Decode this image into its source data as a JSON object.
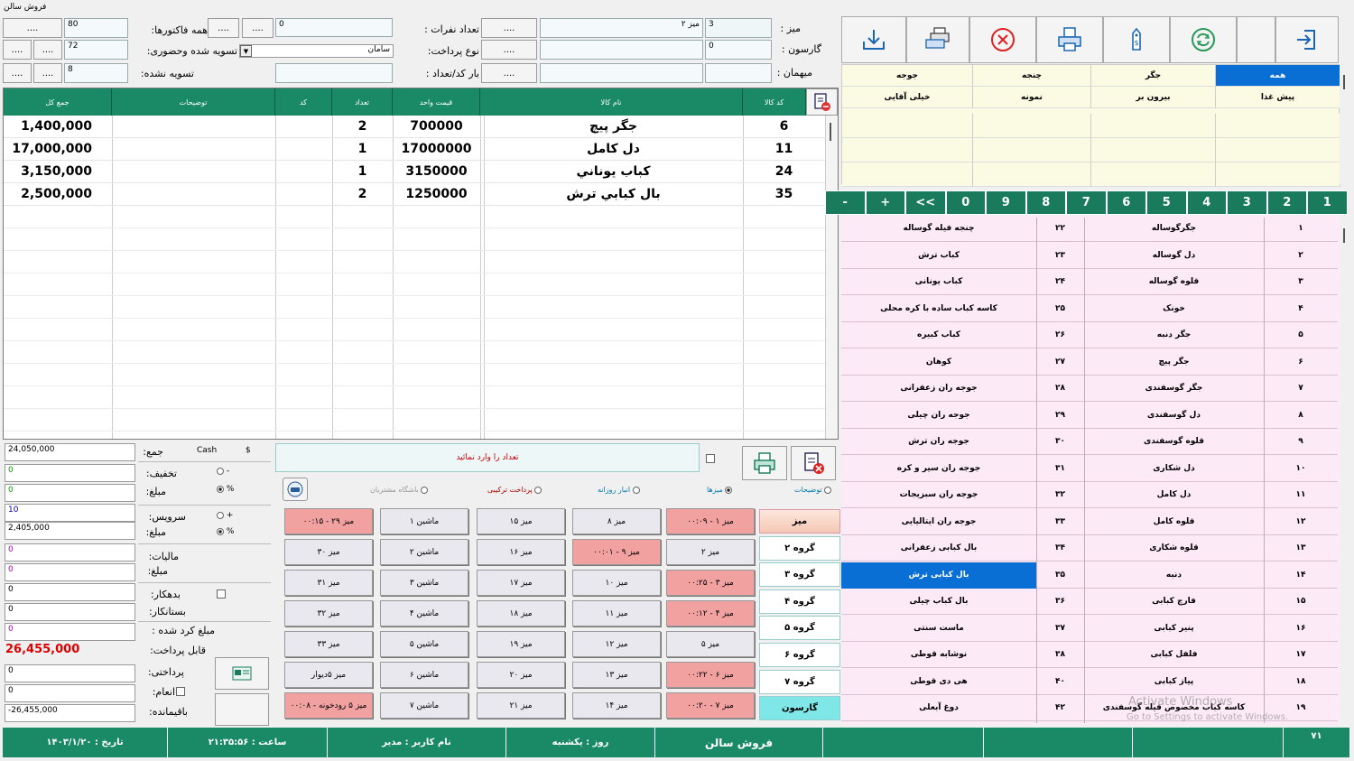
{
  "window": {
    "title": "فروش سالن"
  },
  "header": {
    "table_label": "میز :",
    "table_value": "3",
    "table_name": "میز ۲",
    "waiter_label": "گارسون :",
    "waiter_value": "0",
    "guest_label": "میهمان :",
    "people_label": "تعداد نفرات :",
    "people_value": "0",
    "paytype_label": "نوع پرداخت:",
    "paytype_value": "سامان",
    "barcode_label": "بار کد/تعداد :",
    "all_invoices_label": "همه فاکتورها:",
    "all_invoices_value": "80",
    "settled_label": "تسویه شده وحضوری:",
    "settled_value": "72",
    "unsettled_label": "تسویه نشده:",
    "unsettled_value": "8",
    "ellipsis": "...."
  },
  "grid": {
    "headers": {
      "code": "کد کالا",
      "name": "نام کالا",
      "price": "قیمت واحد",
      "qty": "تعداد",
      "kod": "کد",
      "desc": "توضیحات",
      "total": "جمع کل"
    },
    "rows": [
      {
        "code": "6",
        "name": "جگر پیچ",
        "price": "700000",
        "qty": "2",
        "total": "1,400,000"
      },
      {
        "code": "11",
        "name": "دل کامل",
        "price": "17000000",
        "qty": "1",
        "total": "17,000,000"
      },
      {
        "code": "24",
        "name": "كباب يوناني",
        "price": "3150000",
        "qty": "1",
        "total": "3,150,000"
      },
      {
        "code": "35",
        "name": "بال كبابي ترش",
        "price": "1250000",
        "qty": "2",
        "total": "2,500,000"
      }
    ]
  },
  "summary": {
    "sum_label": "جمع:",
    "sum_value": "24,050,000",
    "cash": "Cash",
    "dollar": "$",
    "discount_label": "تخفیف:",
    "discount_pct": "0",
    "amount_label": "مبلغ:",
    "discount_amount": "0",
    "minus": "-",
    "percent": "%",
    "plus": "+",
    "service_label": "سرویس:",
    "service_pct": "10",
    "service_amount": "2,405,000",
    "tax_label": "مالیات:",
    "tax_amount_label": "مبلغ:",
    "tax_pct": "0",
    "tax_amount": "0",
    "debtor_label": "بدهکار:",
    "debtor_value": "0",
    "creditor_label": "بستانکار:",
    "creditor_value": "0",
    "credited_label": "مبلغ کرد شده :",
    "credited_value": "0",
    "payable_label": "قابل پرداخت:",
    "payable_value": "26,455,000",
    "paid_label": "پرداختی:",
    "paid_value": "0",
    "tip_label": "انعام:",
    "tip_value": "0",
    "remain_label": "باقیمانده:",
    "remain_value": "-26,455,000"
  },
  "messages": {
    "enter_qty": "تعداد را وارد نمائید"
  },
  "options": {
    "desc": "توضیحات",
    "tables": "میزها",
    "daily": "انبار روزانه",
    "combined": "پرداخت ترکیبی",
    "club": "باشگاه مشتریان"
  },
  "tables": [
    [
      "میز ۱ - ۰۰:۰۹",
      "میز ۸",
      "میز ۱۵",
      "ماشین ۱",
      "میز ۲۹ - ۰۰:۱۵"
    ],
    [
      "میز ۲",
      "میز ۹ - ۰۰:۰۱",
      "میز ۱۶",
      "ماشین ۲",
      "میز ۳۰"
    ],
    [
      "میز ۳ - ۰۰:۲۵",
      "میز ۱۰",
      "میز ۱۷",
      "ماشین ۳",
      "میز ۳۱"
    ],
    [
      "میز ۴ - ۰۰:۱۲",
      "میز ۱۱",
      "میز ۱۸",
      "ماشین ۴",
      "میز ۳۲"
    ],
    [
      "میز ۵",
      "میز ۱۲",
      "میز ۱۹",
      "ماشین ۵",
      "میز ۳۳"
    ],
    [
      "میز ۶ - ۰۰:۲۲",
      "میز ۱۳",
      "میز ۲۰",
      "ماشین ۶",
      "میز ۵دیوار"
    ],
    [
      "میز ۷ - ۰۰:۲۰",
      "میز ۱۴",
      "میز ۲۱",
      "ماشین ۷",
      "میز ۵ رودخونه - ۰۰:۰۸"
    ]
  ],
  "groups": [
    "میز",
    "گروه ۲",
    "گروه ۳",
    "گروه ۴",
    "گروه ۵",
    "گروه ۶",
    "گروه ۷",
    "گارسون"
  ],
  "categories": [
    [
      "همه",
      "جگر",
      "چنجه",
      "جوجه"
    ],
    [
      "پیش غذا",
      "بیرون بر",
      "نمونه",
      "خیلی آقایی"
    ]
  ],
  "numpad": [
    "1",
    "2",
    "3",
    "4",
    "5",
    "6",
    "7",
    "8",
    "9",
    "0",
    "<<",
    "+",
    "-"
  ],
  "products": [
    [
      "۱",
      "جگرگوساله",
      "۲۲",
      "چنجه فیله گوساله"
    ],
    [
      "۲",
      "دل گوساله",
      "۲۳",
      "کباب ترش"
    ],
    [
      "۳",
      "قلوه گوساله",
      "۲۴",
      "کباب یونانی"
    ],
    [
      "۴",
      "خونک",
      "۲۵",
      "کاسه کباب ساده با کره محلی"
    ],
    [
      "۵",
      "جگر دنبه",
      "۲۶",
      "کباب کبیره"
    ],
    [
      "۶",
      "جگر پیچ",
      "۲۷",
      "کوهان"
    ],
    [
      "۷",
      "جگر گوسفندی",
      "۲۸",
      "جوجه ران زعفرانی"
    ],
    [
      "۸",
      "دل گوسفندی",
      "۲۹",
      "جوجه ران چیلی"
    ],
    [
      "۹",
      "قلوه گوسفندی",
      "۳۰",
      "جوجه ران ترش"
    ],
    [
      "۱۰",
      "دل شکاری",
      "۳۱",
      "جوجه ران سیر و کره"
    ],
    [
      "۱۱",
      "دل کامل",
      "۳۲",
      "جوجه ران سبزیجات"
    ],
    [
      "۱۲",
      "قلوه کامل",
      "۳۳",
      "جوجه ران ایتالیایی"
    ],
    [
      "۱۳",
      "قلوه شکاری",
      "۳۴",
      "بال کبابی زعفرانی"
    ],
    [
      "۱۴",
      "دنبه",
      "۳۵",
      "بال کبابی ترش"
    ],
    [
      "۱۵",
      "فارچ کبابی",
      "۳۶",
      "بال کباب چیلی"
    ],
    [
      "۱۶",
      "پنیر کبابی",
      "۳۷",
      "ماست سنتی"
    ],
    [
      "۱۷",
      "فلفل کبابی",
      "۳۸",
      "نوشابه قوطی"
    ],
    [
      "۱۸",
      "پیاز کبابی",
      "۴۰",
      "هی دی قوطی"
    ],
    [
      "۱۹",
      "کاسه کباب مخصوص فیله گوسفندی",
      "۴۲",
      "دوغ آبعلی"
    ]
  ],
  "status": {
    "count": "۷۱",
    "title": "فروش سالن",
    "day": "روز : یکشنبه",
    "user": "نام کاربر : مدیر",
    "time": "ساعت : ۲۱:۳۵:۵۶",
    "date": "تاریخ : ۱۴۰۳/۱/۲۰"
  },
  "watermark": {
    "line1": "Activate Windows",
    "line2": "Go to Settings to activate Windows."
  },
  "colors": {
    "green": "#1a8a66",
    "selected": "#0a6fd4",
    "red_table": "#f2a1a1",
    "product_bg": "#fdeaf7"
  }
}
